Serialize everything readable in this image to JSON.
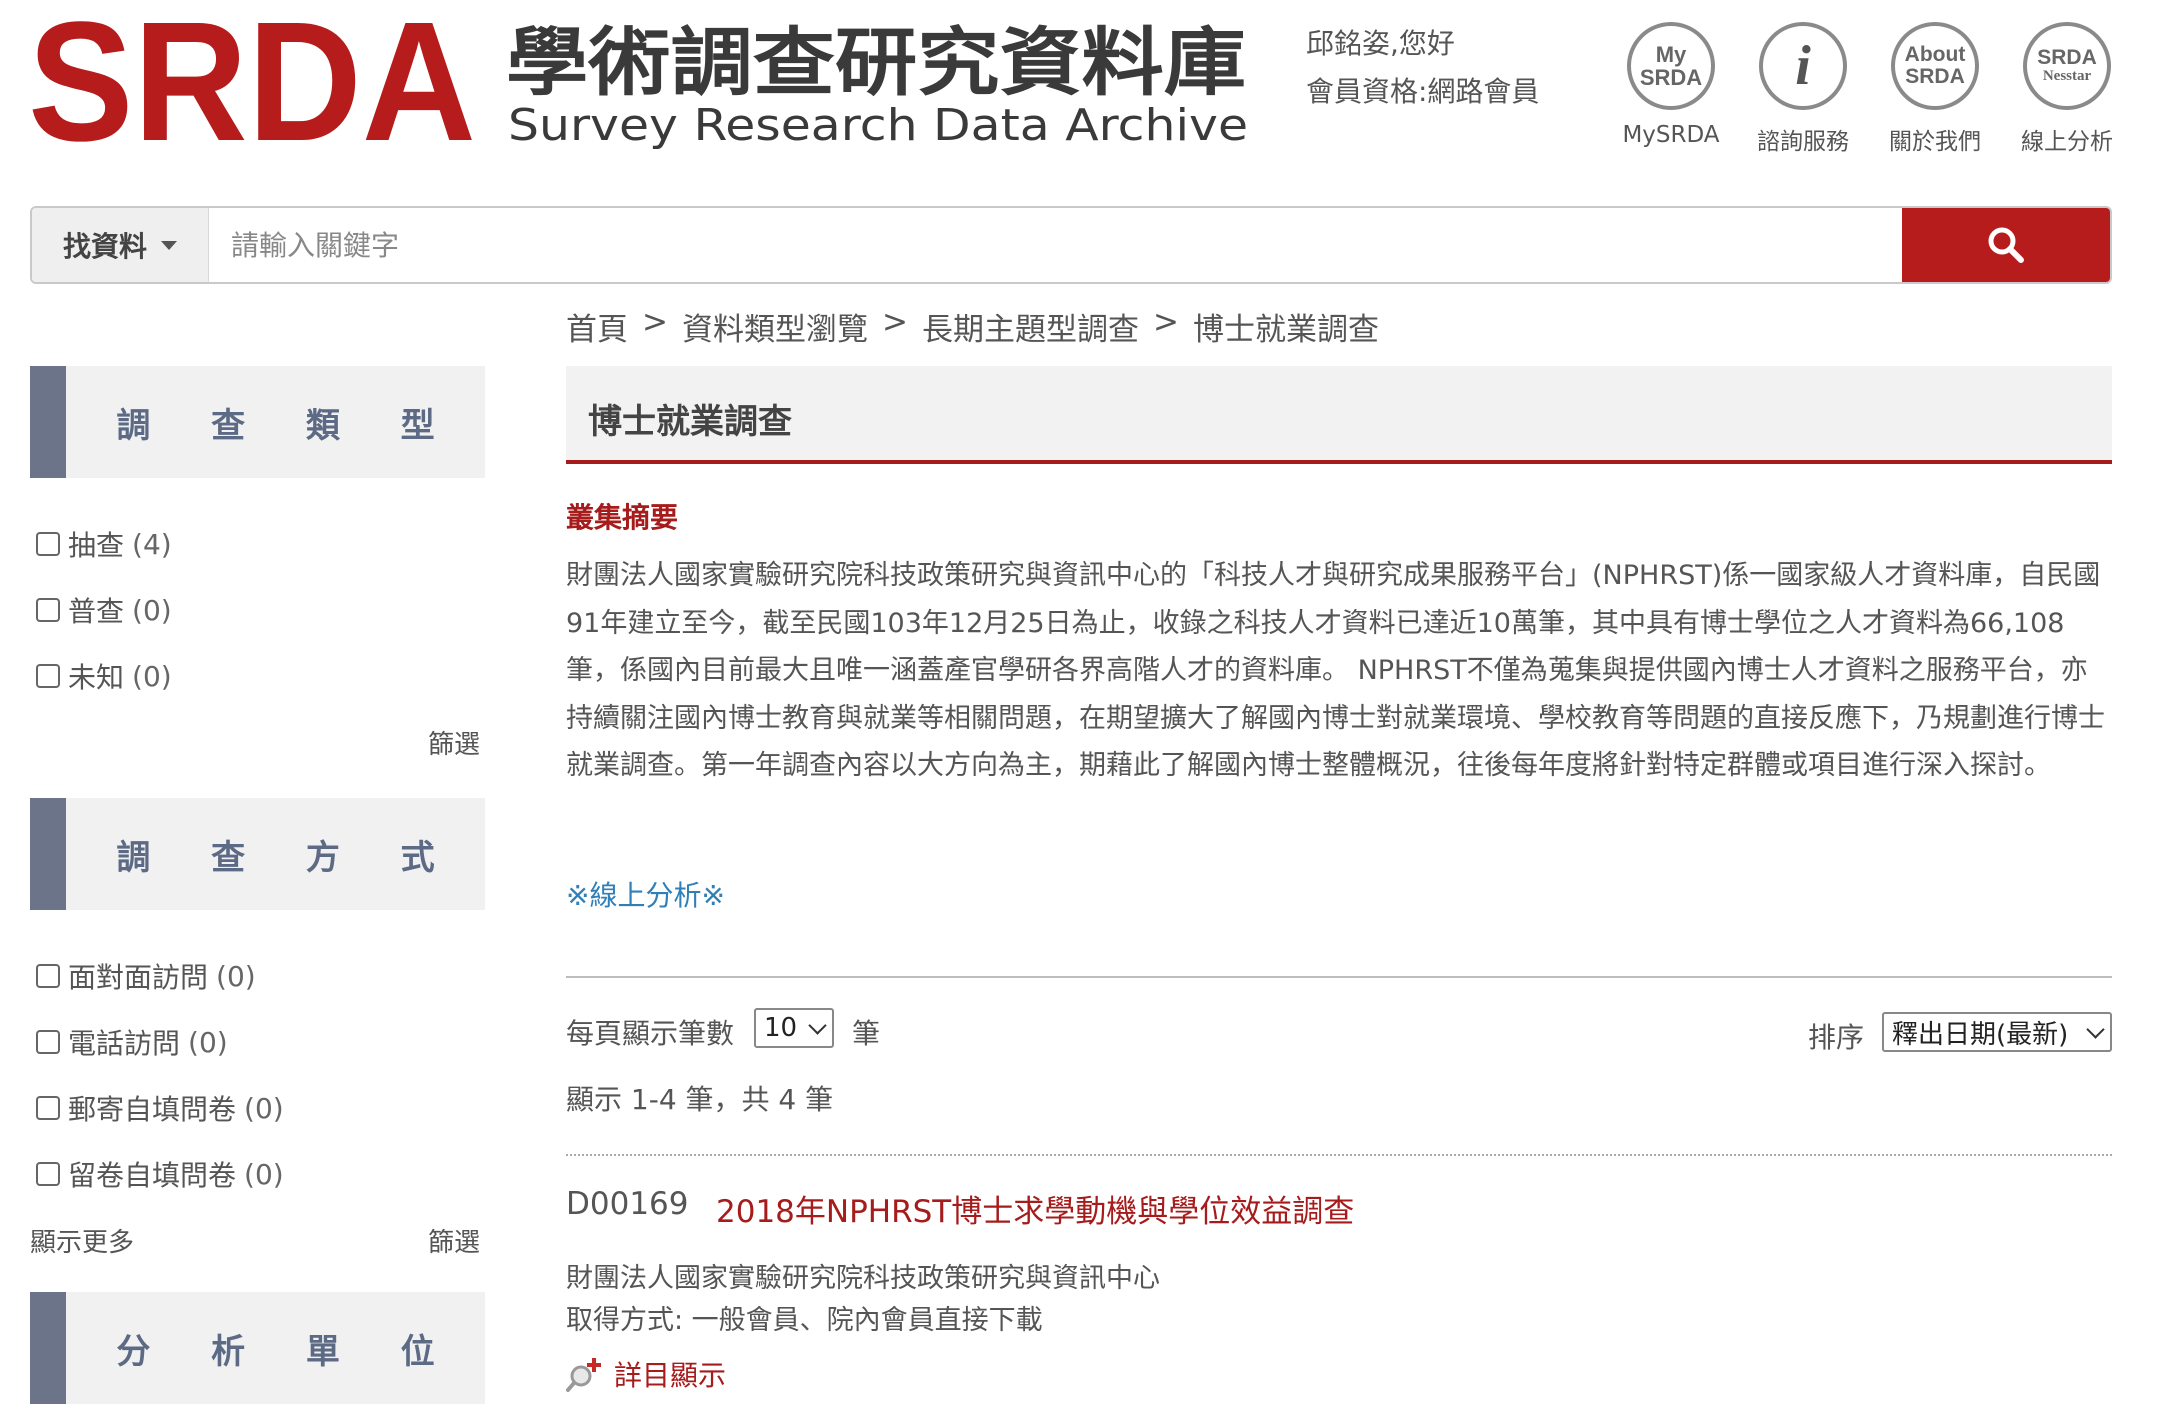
{
  "header": {
    "logo_text": "SRDA",
    "logo_title_zh": "學術調查研究資料庫",
    "logo_title_en": "Survey Research Data Archive",
    "user_greeting": "邱銘姿,您好",
    "member_level": "會員資格:網路會員",
    "nav": [
      {
        "icon_line1": "My",
        "icon_line2": "SRDA",
        "label": "MySRDA"
      },
      {
        "icon_line1": "i",
        "icon_line2": "",
        "label": "諮詢服務"
      },
      {
        "icon_line1": "About",
        "icon_line2": "SRDA",
        "label": "關於我們"
      },
      {
        "icon_line1": "SRDA",
        "icon_line2": "Nesstar",
        "label": "線上分析"
      }
    ]
  },
  "search": {
    "category_label": "找資料",
    "placeholder": "請輸入關鍵字"
  },
  "breadcrumb": [
    "首頁",
    "資料類型瀏覽",
    "長期主題型調查",
    "博士就業調查"
  ],
  "sidebar": {
    "facets": [
      {
        "title_chars": [
          "調",
          "查",
          "類",
          "型"
        ],
        "items": [
          {
            "label": "抽查",
            "count": "(4)"
          },
          {
            "label": "普查",
            "count": "(0)"
          },
          {
            "label": "未知",
            "count": "(0)"
          }
        ],
        "filter_label": "篩選"
      },
      {
        "title_chars": [
          "調",
          "查",
          "方",
          "式"
        ],
        "items": [
          {
            "label": "面對面訪問",
            "count": "(0)"
          },
          {
            "label": "電話訪問",
            "count": "(0)"
          },
          {
            "label": "郵寄自填問卷",
            "count": "(0)"
          },
          {
            "label": "留卷自填問卷",
            "count": "(0)"
          }
        ],
        "more_label": "顯示更多",
        "filter_label": "篩選"
      },
      {
        "title_chars": [
          "分",
          "析",
          "單",
          "位"
        ],
        "items": []
      }
    ]
  },
  "main": {
    "collection_title": "博士就業調查",
    "summary_label": "叢集摘要",
    "summary_text": "財團法人國家實驗研究院科技政策研究與資訊中心的「科技人才與研究成果服務平台」(NPHRST)係一國家級人才資料庫，自民國91年建立至今，截至民國103年12月25日為止，收錄之科技人才資料已達近10萬筆，其中具有博士學位之人才資料為66,108筆，係國內目前最大且唯一涵蓋產官學研各界高階人才的資料庫。 NPHRST不僅為蒐集與提供國內博士人才資料之服務平台，亦持續關注國內博士教育與就業等相關問題，在期望擴大了解國內博士對就業環境、學校教育等問題的直接反應下，乃規劃進行博士就業調查。第一年調查內容以大方向為主，期藉此了解國內博士整體概況，往後每年度將針對特定群體或項目進行深入探討。",
    "online_analysis_link": "※線上分析※",
    "page_size_label": "每頁顯示筆數",
    "page_size_value": "10",
    "page_size_unit": "筆",
    "sort_label": "排序",
    "sort_value": "釋出日期(最新)",
    "result_count": "顯示 1-4 筆，共 4 筆"
  },
  "records": [
    {
      "id": "D00169",
      "title": "2018年NPHRST博士求學動機與學位效益調查",
      "organization": "財團法人國家實驗研究院科技政策研究與資訊中心",
      "access": "取得方式: 一般會員、院內會員直接下載",
      "detail_label": "詳目顯示"
    }
  ],
  "colors": {
    "brand_red": "#b71c1c",
    "facet_bar": "#6b7489",
    "link_blue": "#2f7fb8"
  }
}
